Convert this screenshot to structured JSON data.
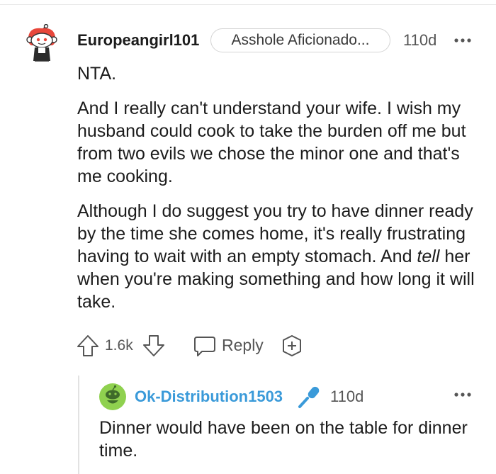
{
  "comment": {
    "author": "Europeangirl101",
    "flair": "Asshole Aficionado...",
    "time": "110d",
    "verdict": "NTA.",
    "paragraph_1": "And I really can't understand your wife. I wish my husband could cook to take the burden off me but from two evils we chose the minor one and that's me cooking.",
    "paragraph_2_before": "Although I do suggest you try to have dinner ready by the time she comes home, it's really frustrating having to wait with an empty stomach. And ",
    "paragraph_2_emphasis": "tell",
    "paragraph_2_after": " her when you're making something and how long it will take.",
    "score": "1.6k",
    "reply_label": "Reply",
    "avatar_icon": "snoo-avatar-icon"
  },
  "reply": {
    "author": "Ok-Distribution1503",
    "time": "110d",
    "text": "Dinner would have been on the table for dinner time.",
    "avatar_icon": "green-snoo-avatar-icon",
    "badge_icon": "microphone-icon"
  },
  "colors": {
    "text": "#1c1c1c",
    "muted": "#555555",
    "reply_author": "#3a9ad9",
    "divider": "#e2e2e2",
    "avatar_green": "#8fd14f"
  }
}
